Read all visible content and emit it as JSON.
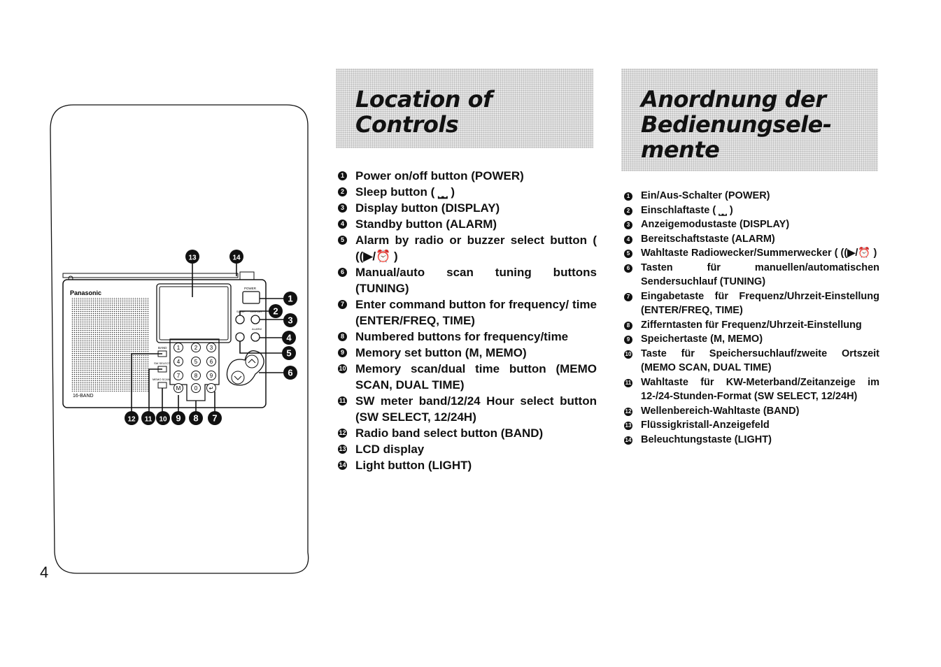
{
  "page_number": "4",
  "english": {
    "title_line1": "Location of",
    "title_line2": "Controls",
    "items": [
      {
        "num": "1",
        "text": "Power on/off button (POWER)"
      },
      {
        "num": "2",
        "text": "Sleep button ( ⎵⎵ )"
      },
      {
        "num": "3",
        "text": "Display button (DISPLAY)"
      },
      {
        "num": "4",
        "text": "Standby button (ALARM)"
      },
      {
        "num": "5",
        "text": "Alarm by radio or buzzer select button ( ((▶/⏰ )"
      },
      {
        "num": "6",
        "text": "Manual/auto scan tuning buttons (TUNING)"
      },
      {
        "num": "7",
        "text": "Enter command button for frequency/ time (ENTER/FREQ, TIME)"
      },
      {
        "num": "8",
        "text": "Numbered buttons for frequency/time"
      },
      {
        "num": "9",
        "text": "Memory set button (M, MEMO)"
      },
      {
        "num": "10",
        "text": "Memory scan/dual time button (MEMO SCAN, DUAL TIME)"
      },
      {
        "num": "11",
        "text": "SW meter band/12/24 Hour select button (SW SELECT, 12/24H)"
      },
      {
        "num": "12",
        "text": "Radio band select button (BAND)"
      },
      {
        "num": "13",
        "text": "LCD display"
      },
      {
        "num": "14",
        "text": "Light button (LIGHT)"
      }
    ]
  },
  "german": {
    "title_line1": "Anordnung der",
    "title_line2": "Bedienungsele-",
    "title_line3": "mente",
    "items": [
      {
        "num": "1",
        "text": "Ein/Aus-Schalter (POWER)"
      },
      {
        "num": "2",
        "text": "Einschlaftaste ( ⎵⎵ )"
      },
      {
        "num": "3",
        "text": "Anzeigemodustaste (DISPLAY)"
      },
      {
        "num": "4",
        "text": "Bereitschaftstaste (ALARM)"
      },
      {
        "num": "5",
        "text": "Wahltaste Radiowecker/Summerwecker ( ((▶/⏰ )"
      },
      {
        "num": "6",
        "text": "Tasten für manuellen/automatischen Sendersuchlauf (TUNING)"
      },
      {
        "num": "7",
        "text": "Eingabetaste für Frequenz/Uhrzeit-Einstellung (ENTER/FREQ, TIME)"
      },
      {
        "num": "8",
        "text": "Zifferntasten für Frequenz/Uhrzeit-Einstellung"
      },
      {
        "num": "9",
        "text": "Speichertaste (M, MEMO)"
      },
      {
        "num": "10",
        "text": "Taste für Speichersuchlauf/zweite Ortszeit (MEMO SCAN, DUAL TIME)"
      },
      {
        "num": "11",
        "text": "Wahltaste für KW-Meterband/Zeitanzeige im 12-/24-Stunden-Format (SW SELECT, 12/24H)"
      },
      {
        "num": "12",
        "text": "Wellenbereich-Wahltaste (BAND)"
      },
      {
        "num": "13",
        "text": "Flüssigkristall-Anzeigefeld"
      },
      {
        "num": "14",
        "text": "Beleuchtungstaste (LIGHT)"
      }
    ]
  },
  "diagram": {
    "brand": "Panasonic",
    "band_label": "16-BAND",
    "power_label": "POWER",
    "display_label": "DISPLAY",
    "sleep_label": "SLEEP",
    "alarm_label": "ALARM",
    "band_button_label": "BAND",
    "sw_select_label": "SW SELECT",
    "memo_scan_label": "MEMO SCAN",
    "keys": [
      "1",
      "2",
      "3",
      "4",
      "5",
      "6",
      "7",
      "8",
      "9",
      "M",
      "0",
      "↵"
    ],
    "callouts": [
      "1",
      "2",
      "3",
      "4",
      "5",
      "6",
      "7",
      "8",
      "9",
      "10",
      "11",
      "12",
      "13",
      "14"
    ]
  }
}
